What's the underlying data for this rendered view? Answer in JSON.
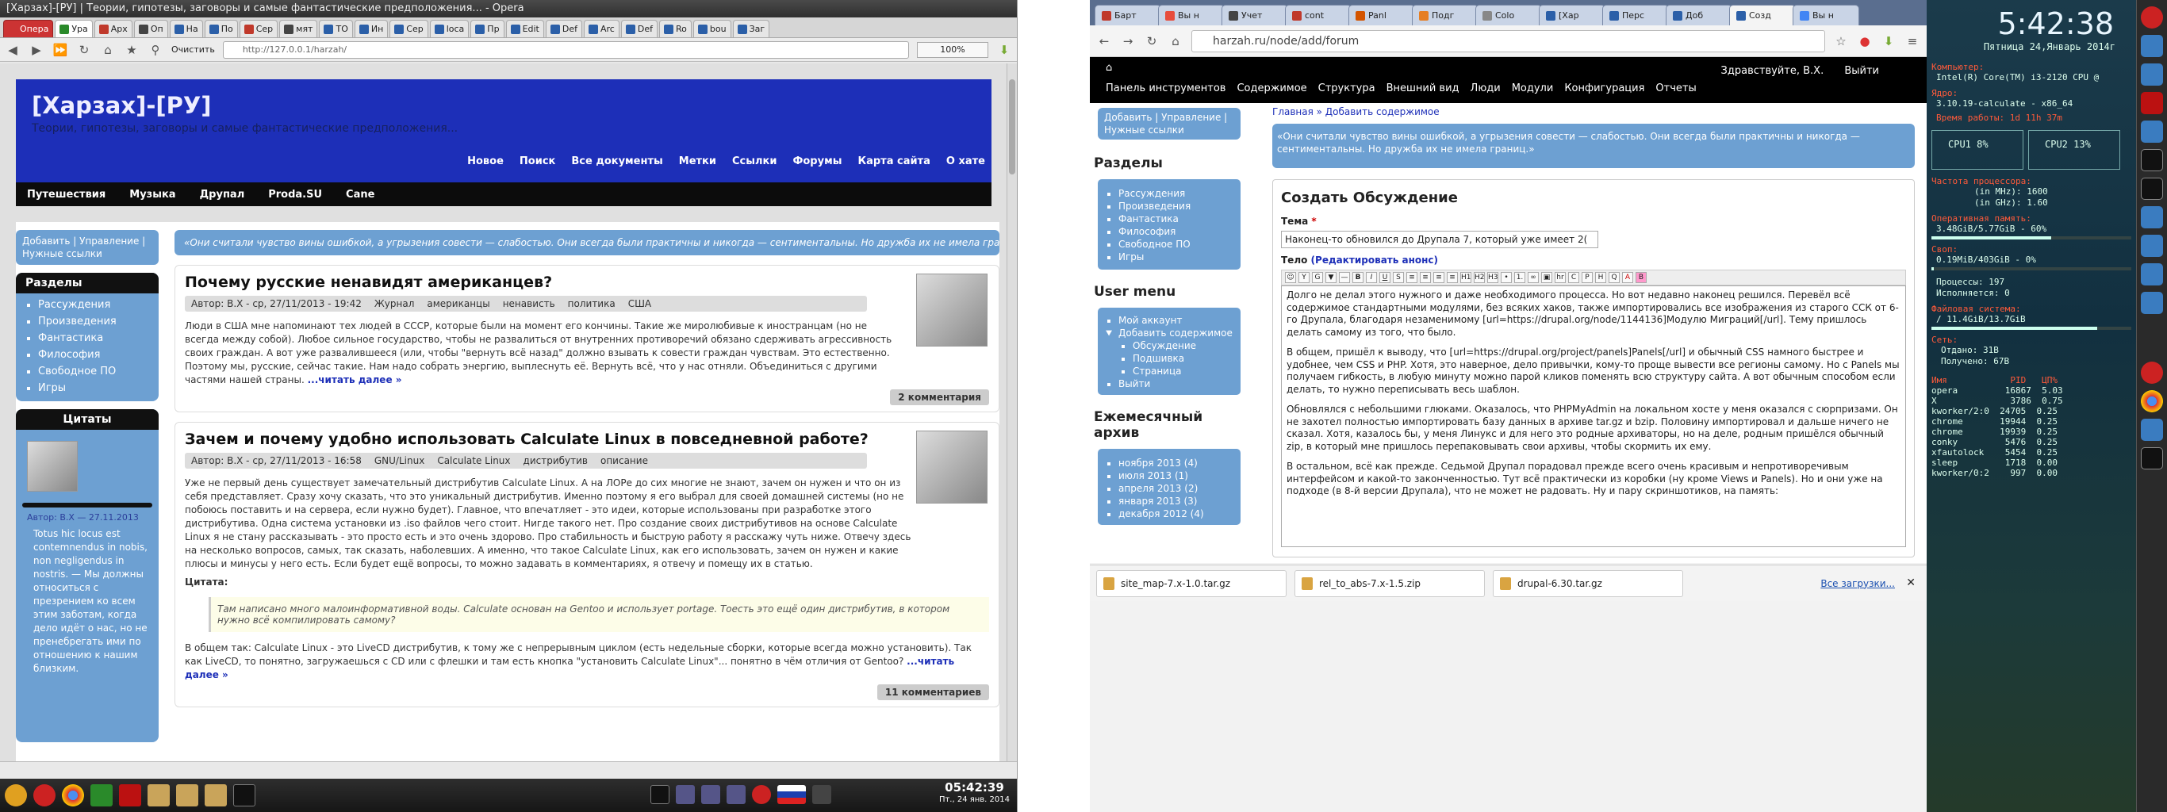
{
  "left_window": {
    "title": "[Харзах]-[РУ] | Теории, гипотезы, заговоры и самые фантастические предположения... - Opera",
    "tabs": [
      {
        "label": "Опера",
        "color": "#c33"
      },
      {
        "label": "Ура",
        "color": "#2a8a2a"
      },
      {
        "label": "Арх",
        "color": "#c0392b"
      },
      {
        "label": "Оп",
        "color": "#444"
      },
      {
        "label": "На",
        "color": "#2b5fa8"
      },
      {
        "label": "По",
        "color": "#2b5fa8"
      },
      {
        "label": "Сер",
        "color": "#c0392b"
      },
      {
        "label": "мят",
        "color": "#444"
      },
      {
        "label": "ТО",
        "color": "#2b5fa8"
      },
      {
        "label": "Ин",
        "color": "#2b5fa8"
      },
      {
        "label": "Сер",
        "color": "#2b5fa8"
      },
      {
        "label": "loca",
        "color": "#2b5fa8"
      },
      {
        "label": "Пр",
        "color": "#2b5fa8"
      },
      {
        "label": "Edit",
        "color": "#2b5fa8"
      },
      {
        "label": "Def",
        "color": "#2b5fa8"
      },
      {
        "label": "Arc",
        "color": "#2b5fa8"
      },
      {
        "label": "Def",
        "color": "#2b5fa8"
      },
      {
        "label": "Ro",
        "color": "#2b5fa8"
      },
      {
        "label": "bou",
        "color": "#2b5fa8"
      },
      {
        "label": "Заг",
        "color": "#2b5fa8"
      }
    ],
    "nav": {
      "clear_label": "Очистить",
      "url": "http://127.0.0.1/harzah/",
      "zoom": "100%"
    },
    "site": {
      "title": "[Харзах]-[РУ]",
      "slogan": "Теории, гипотезы, заговоры и самые фантастические предположения...",
      "top_nav": [
        "Новое",
        "Поиск",
        "Все документы",
        "Метки",
        "Ссылки",
        "Форумы",
        "Карта сайта",
        "О хате"
      ],
      "black_nav": [
        "Путешествия",
        "Музыка",
        "Друпал",
        "Proda.SU",
        "Сane"
      ],
      "user_links": "Добавить | Управление | Нужные ссылки",
      "banner_quote": "«Они считали чувство вины ошибкой, а угрызения совести — слабостью. Они всегда были практичны и никогда — сентиментальны. Но дружба их не имела границ.»",
      "sections_title": "Разделы",
      "sections": [
        "Рассуждения",
        "Произведения",
        "Фантастика",
        "Философия",
        "Свободное ПО",
        "Игры"
      ],
      "quotes_title": "Цитаты",
      "quote_author": "Автор: B.X — 27.11.2013",
      "quote_text": "Totus hic locus est contemnendus in nobis, non negligendus in nostris. — Мы должны относиться с презрением ко всем этим заботам, когда дело идёт о нас, но не пренебрегать ими по отношению к нашим близким.",
      "articles": [
        {
          "title": "Почему русские ненавидят американцев?",
          "meta": "Автор: B.X - ср, 27/11/2013 - 19:42",
          "tags": [
            "Журнал",
            "американцы",
            "ненависть",
            "политика",
            "США"
          ],
          "body": "Люди в США мне напоминают тех людей в СССР, которые были на момент его кончины. Такие же миролюбивые к иностранцам (но не всегда между собой). Любое сильное государство, чтобы не развалиться от внутренних противоречий обязано сдерживать агрессивность своих граждан. А вот уже развалившееся (или, чтобы \"вернуть всё назад\" должно взывать к совести граждан чувствам. Это естественно. Поэтому мы, русские, сейчас такие. Нам надо собрать энергию, выплеснуть её. Вернуть всё, что у нас отняли. Объединиться с другими частями нашей страны.",
          "more": "...читать далее »",
          "comments": "2 комментария"
        },
        {
          "title": "Зачем и почему удобно использовать Calculate Linux в повседневной работе?",
          "meta": "Автор: B.X - ср, 27/11/2013 - 16:58",
          "tags": [
            "GNU/Linux",
            "Calculate Linux",
            "дистрибутив",
            "описание"
          ],
          "body": "Уже не первый день существует замечательный дистрибутив Calculate Linux. А на ЛОРе до сих многие не знают, зачем он нужен и что он из себя представляет. Сразу хочу сказать, что это уникальный дистрибутив. Именно поэтому я его выбрал для своей домашней системы (но не побоюсь поставить и на сервера, если нужно будет). Главное, что впечатляет - это идеи, которые использованы при разработке этого дистрибутива. Одна система установки из .iso файлов чего стоит. Нигде такого нет. Про создание своих дистрибутивов на основе Calculate Linux я не стану рассказывать - это просто есть и это очень здорово. Про стабильность и быструю работу я расскажу чуть ниже. Отвечу здесь на несколько вопросов, самых, так сказать, наболевших. А именно, что такое Calculate Linux, как его использовать, зачем он нужен и какие плюсы и минусы у него есть. Если будет ещё вопросы, то можно задавать в комментариях, я отвечу и помещу их в статью.",
          "cite_label": "Цитата:",
          "cite": "Там написано много малоинформативной воды. Calculate основан на Gentoo и использует portage. Тоесть это ещё один дистрибутив, в котором нужно всё компилировать самому?",
          "body2": "В общем так: Calculate Linux - это LiveCD дистрибутив, к тому же с непрерывным циклом (есть недельные сборки, которые всегда можно установить). Так как LiveCD, то понятно, загружаешься с CD или с флешки и там есть кнопка \"установить Calculate Linux\"... понятно в чём отличия от Gentoo?",
          "more": "...читать далее »",
          "comments": "11 комментариев"
        }
      ]
    },
    "taskbar": {
      "time": "05:42:39",
      "date": "Пт., 24 янв. 2014"
    }
  },
  "right_window": {
    "tabs": [
      {
        "label": "Барт",
        "color": "#c0392b"
      },
      {
        "label": "Вы н",
        "color": "#e74c3c"
      },
      {
        "label": "Учет",
        "color": "#444"
      },
      {
        "label": "cont",
        "color": "#c0392b"
      },
      {
        "label": "Panl",
        "color": "#d35400"
      },
      {
        "label": "Подг",
        "color": "#e67e22"
      },
      {
        "label": "Colo",
        "color": "#888"
      },
      {
        "label": "[Хар",
        "color": "#2b5fa8"
      },
      {
        "label": "Перс",
        "color": "#2b5fa8"
      },
      {
        "label": "Доб",
        "color": "#2b5fa8"
      },
      {
        "label": "Созд",
        "color": "#2b5fa8"
      },
      {
        "label": "Вы н",
        "color": "#4285f4"
      }
    ],
    "url": "harzah.ru/node/add/forum",
    "toolbar": {
      "links": [
        "Панель инструментов",
        "Содержимое",
        "Структура",
        "Внешний вид",
        "Люди",
        "Модули",
        "Конфигурация",
        "Отчеты"
      ],
      "hello": "Здравствуйте, B.X.",
      "logout": "Выйти"
    },
    "user_links": "Добавить | Управление | Нужные ссылки",
    "breadcrumb": "Главная » Добавить содержимое",
    "quote": "«Они считали чувство вины ошибкой, а угрызения совести — слабостью. Они всегда были практичны и никогда — сентиментальны. Но дружба их не имела границ.»",
    "sections_title": "Разделы",
    "sections": [
      "Рассуждения",
      "Произведения",
      "Фантастика",
      "Философия",
      "Свободное ПО",
      "Игры"
    ],
    "user_menu_title": "User menu",
    "user_menu": [
      "Мой аккаунт",
      "Добавить содержимое",
      "Обсуждение",
      "Подшивка",
      "Страница",
      "Выйти"
    ],
    "archive_title": "Ежемесячный архив",
    "archive": [
      "ноября 2013 (4)",
      "июля 2013 (1)",
      "апреля 2013 (2)",
      "января 2013 (3)",
      "декабря 2012 (4)"
    ],
    "form": {
      "title": "Создать Обсуждение",
      "subject_label": "Тема",
      "subject_value": "Наконец-то обновился до Друпала 7, который уже имеет 2(",
      "body_label": "Тело",
      "body_edit_summary": "(Редактировать анонс)",
      "paragraphs": [
        "Долго не делал этого нужного и даже необходимого процесса. Но вот недавно наконец решился. Перевёл всё содержимое стандартными модулями, без всяких хаков, также импортировались все изображения из старого ССК от 6-го Друпала, благодаря незаменимому [url=https://drupal.org/node/1144136]Модулю Миграций[/url]. Тему пришлось делать самому из того, что было.",
        "В общем, пришёл к выводу, что [url=https://drupal.org/project/panels]Panels[/url] и обычный CSS намного быстрее и удобнее, чем CSS и PHP. Хотя, это наверное, дело привычки, кому-то проще вывести все регионы самому. Но с Panels мы получаем гибкость, в любую минуту можно парой кликов поменять всю структуру сайта. А вот обычным способом если делать, то нужно переписывать весь шаблон.",
        "Обновлялся с небольшими глюками. Оказалось, что PHPMyAdmin на локальном хосте у меня оказался с сюрпризами. Он не захотел полностью импортировать базу данных в архиве tar.gz и bzip. Половину импортировал и дальше ничего не сказал. Хотя, казалось бы, у меня Линукс и для него это родные архиваторы, но на деле, родным пришёлся обычный zip, в который мне пришлось перепаковывать свои архивы, чтобы скормить их ему.",
        "В остальном, всё как прежде. Седьмой Друпал порадовал прежде всего очень красивым и непротиворечивым интерфейсом и какой-то законченностью. Тут всё практически из коробки (ну кроме Views и Panels). Но и они уже на подходе (в 8-й версии Друпала), что не может не радовать. Ну и пару скриншотиков, на память:"
      ]
    },
    "downloads": [
      {
        "name": "site_map-7.x-1.0.tar.gz"
      },
      {
        "name": "rel_to_abs-7.x-1.5.zip"
      },
      {
        "name": "drupal-6.30.tar.gz"
      }
    ],
    "downloads_all": "Все загрузки..."
  },
  "conky": {
    "time": "5:42:38",
    "date": "Пятница 24,Январь 2014г",
    "cpu_label": "Компьютер:",
    "cpu_model": "Intel(R) Core(TM) i3-2120 CPU @",
    "kernel_label": "Ядро:",
    "kernel": "3.10.19-calculate - x86_64",
    "uptime": "Время работы: 1d 11h 37m",
    "cpu1": "CPU1  8%",
    "cpu2": "CPU2  13%",
    "freq_label": "Частота процессора:",
    "freq": "(in MHz): 1600\n(in GHz): 1.60",
    "ram_label": "Оперативная память:",
    "ram": "3.48GiB/5.77GiB - 60%",
    "swap_label": "Своп:",
    "swap": "0.19MiB/403GiB - 0%",
    "procs": "Процессы: 197",
    "running": "Исполняется: 0",
    "fs_label": "Файловая система:",
    "fs": "/ 11.4GiB/13.7GiB",
    "net_label": "Сеть:",
    "net": "Отдано: 31B\nПолучено: 67B",
    "proc_header": "Имя            PID   ЦП%",
    "procs_list": [
      "opera         16867  5.03",
      "X              3786  0.75",
      "kworker/2:0  24705  0.25",
      "chrome       19944  0.25",
      "chrome       19939  0.25",
      "conky         5476  0.25",
      "xfautolock    5454  0.25",
      "sleep         1718  0.00",
      "kworker/0:2    997  0.00"
    ]
  }
}
